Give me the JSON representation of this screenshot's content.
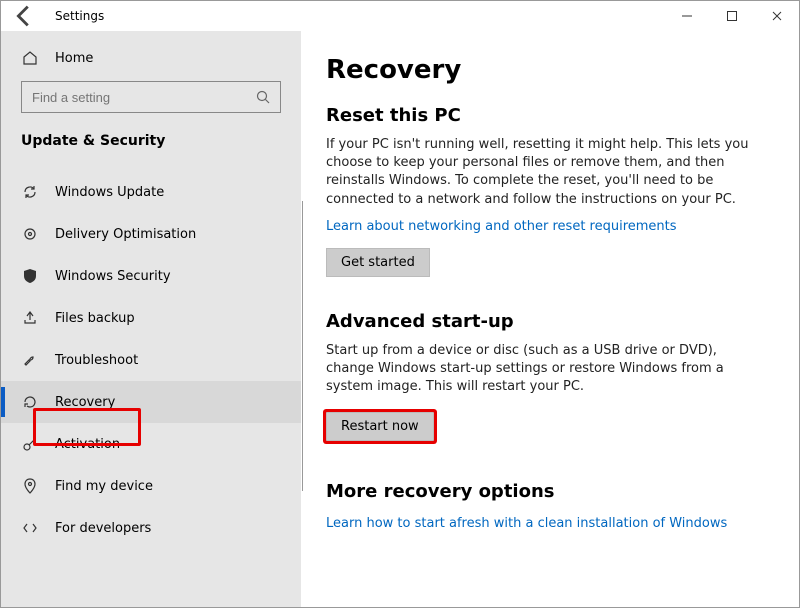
{
  "window": {
    "title": "Settings"
  },
  "sidebar": {
    "home_label": "Home",
    "search_placeholder": "Find a setting",
    "section_label": "Update & Security",
    "items": [
      {
        "label": "Windows Update"
      },
      {
        "label": "Delivery Optimisation"
      },
      {
        "label": "Windows Security"
      },
      {
        "label": "Files backup"
      },
      {
        "label": "Troubleshoot"
      },
      {
        "label": "Recovery"
      },
      {
        "label": "Activation"
      },
      {
        "label": "Find my device"
      },
      {
        "label": "For developers"
      }
    ]
  },
  "main": {
    "title": "Recovery",
    "reset": {
      "heading": "Reset this PC",
      "body": "If your PC isn't running well, resetting it might help. This lets you choose to keep your personal files or remove them, and then reinstalls Windows. To complete the reset, you'll need to be connected to a network and follow the instructions on your PC.",
      "link": "Learn about networking and other reset requirements",
      "button": "Get started"
    },
    "advanced": {
      "heading": "Advanced start-up",
      "body": "Start up from a device or disc (such as a USB drive or DVD), change Windows start-up settings or restore Windows from a system image. This will restart your PC.",
      "button": "Restart now"
    },
    "more": {
      "heading": "More recovery options",
      "link": "Learn how to start afresh with a clean installation of Windows"
    }
  }
}
